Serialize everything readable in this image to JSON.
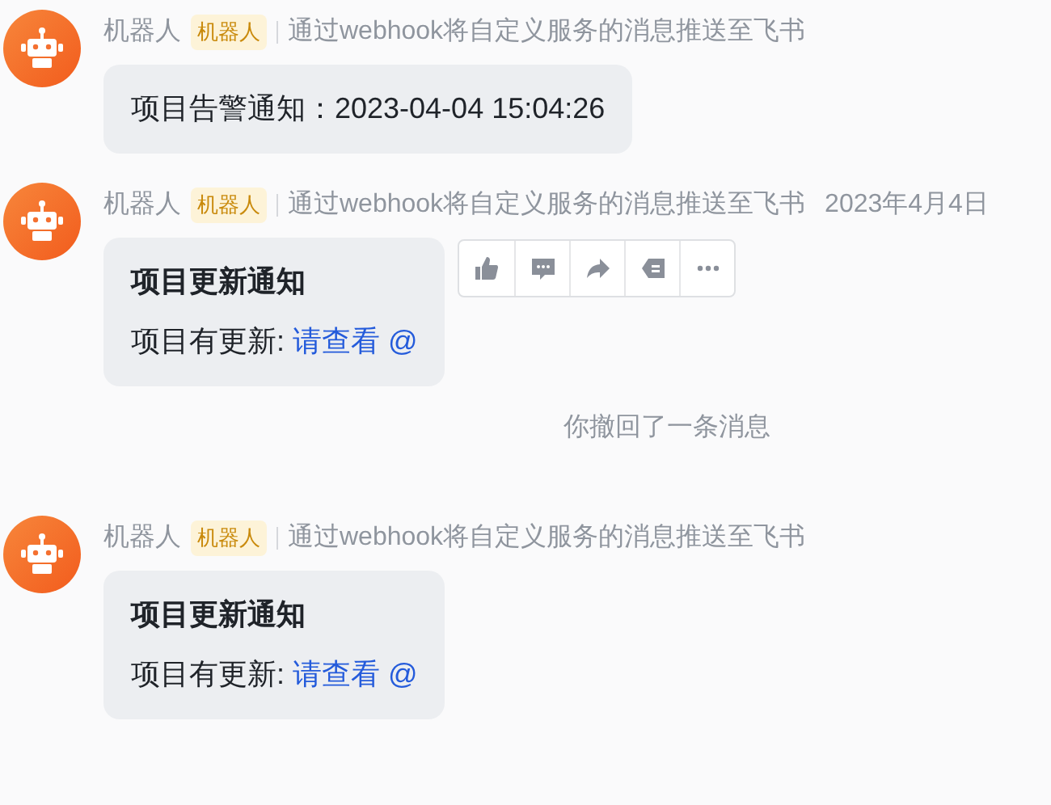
{
  "messages": [
    {
      "kind": "message",
      "sender": "机器人",
      "tag": "机器人",
      "description": "通过webhook将自定义服务的消息推送至飞书",
      "body": {
        "text": "项目告警通知：2023-04-04 15:04:26"
      }
    },
    {
      "kind": "message",
      "sender": "机器人",
      "tag": "机器人",
      "description": "通过webhook将自定义服务的消息推送至飞书",
      "time": "2023年4月4日",
      "body": {
        "title": "项目更新通知",
        "text": "项目有更新: ",
        "link": "请查看 @"
      },
      "actions": [
        {
          "kind": "like"
        },
        {
          "kind": "reply"
        },
        {
          "kind": "forward"
        },
        {
          "kind": "pin"
        },
        {
          "kind": "more"
        }
      ]
    },
    {
      "kind": "recall",
      "text": "你撤回了一条消息"
    },
    {
      "kind": "message",
      "sender": "机器人",
      "tag": "机器人",
      "description": "通过webhook将自定义服务的消息推送至飞书",
      "body": {
        "title": "项目更新通知",
        "text": "项目有更新: ",
        "link": "请查看 @"
      }
    }
  ]
}
